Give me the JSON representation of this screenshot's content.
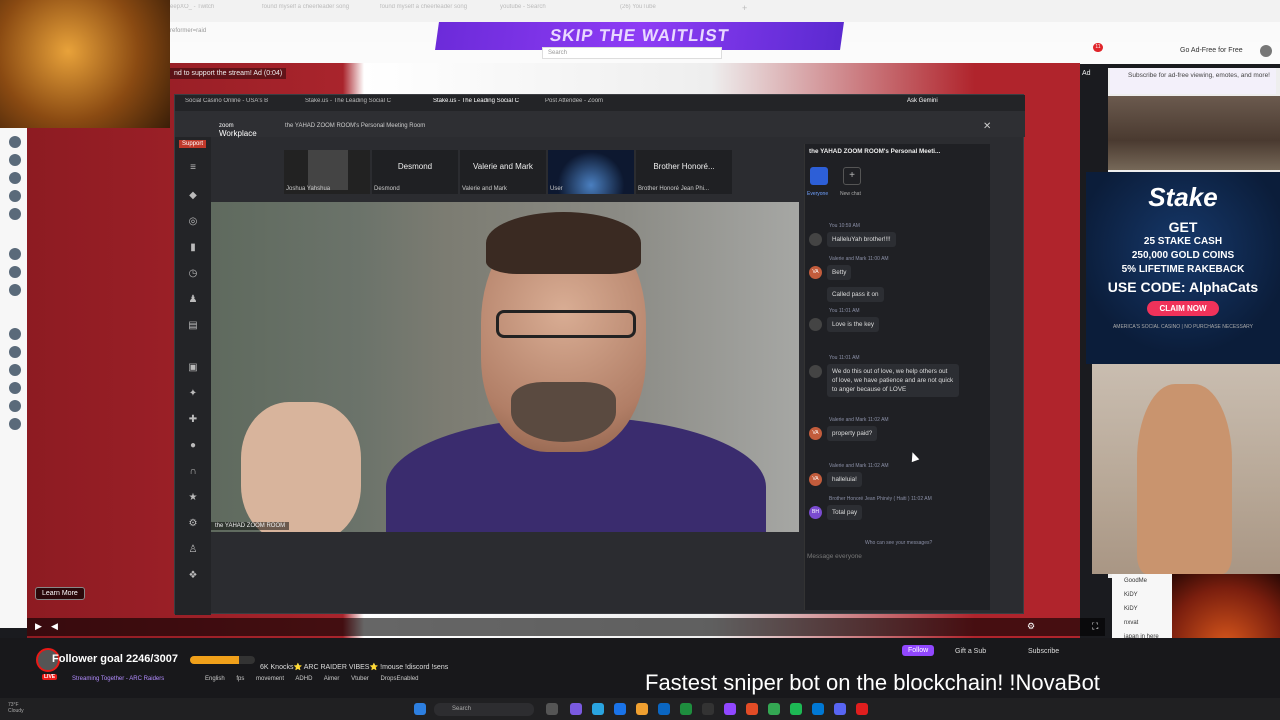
{
  "browser": {
    "tabs": [
      {
        "label": "eepXO_ - Twitch"
      },
      {
        "label": "found myself a cheerleader song"
      },
      {
        "label": "found myself a cheerleader song"
      },
      {
        "label": "youtube - Search"
      },
      {
        "label": "(26) YouTube"
      }
    ],
    "url": "reformer=raid",
    "banner": "SKIP THE WAITLIST",
    "search_placeholder": "Search",
    "ad_free_label": "Go Ad-Free for Free",
    "badge_count": "11"
  },
  "stream": {
    "ad_notice": "nd to support the stream! Ad (0:04)",
    "ad_label": "Ad",
    "learn_more": "Learn More",
    "goal_text": "Follower goal 2246/3007",
    "goal_fraction": 0.75,
    "title": "6K Knocks⭐ ARC RAIDER VIBES⭐ !mouse !discord !sens",
    "live_badge": "LIVE",
    "category": "Streaming Together - ARC Raiders",
    "tags": [
      "English",
      "fps",
      "movement",
      "ADHD",
      "Aimer",
      "Vtuber",
      "DropsEnabled"
    ],
    "follow_label": "Follow",
    "gift_label": "Gift a Sub",
    "subscribe_label": "Subscribe",
    "ticker": "Fastest sniper bot on the blockchain! !NovaBot"
  },
  "inner_browser": {
    "tabs": [
      {
        "label": "Social Casino Online - USA's B"
      },
      {
        "label": "Stake.us - The Leading Social C"
      },
      {
        "label": "Stake.us - The Leading Social C"
      },
      {
        "label": "Post Attendee - Zoom"
      }
    ],
    "ask_gemini": "Ask Gemini"
  },
  "zoom": {
    "logo_top": "zoom",
    "logo_bottom": "Workplace",
    "meeting_title": "the YAHAD ZOOM ROOM's Personal Meeting Room",
    "support_label": "Support",
    "participants": [
      {
        "name": "",
        "label": "Joshua Yahshua"
      },
      {
        "name": "Desmond",
        "label": "Desmond"
      },
      {
        "name": "Valerie and Mark",
        "label": "Valerie and Mark"
      },
      {
        "name": "",
        "label": "User"
      },
      {
        "name": "Brother  Honoré...",
        "label": "Brother Honoré Jean Phi..."
      }
    ],
    "main_video_label": "the YAHAD ZOOM ROOM",
    "chat": {
      "title": "the YAHAD ZOOM ROOM's Personal Meeti...",
      "tab_everyone": "Everyone",
      "tab_new": "New chat",
      "messages": [
        {
          "meta": "You 10:59 AM",
          "text": "HalleluYah brother!!!!",
          "avatar": ""
        },
        {
          "meta": "Valerie and Mark 11:00 AM",
          "text": "Betty",
          "avatar": "VA"
        },
        {
          "meta": "",
          "text": "Called pass it on",
          "avatar": ""
        },
        {
          "meta": "You 11:01 AM",
          "text": "Love is the key",
          "avatar": ""
        },
        {
          "meta": "You 11:01 AM",
          "text": "We do this out of love, we help others out of love, we have patience and are not quick to anger because of LOVE",
          "avatar": ""
        },
        {
          "meta": "Valerie and Mark 11:02 AM",
          "text": "property paid?",
          "avatar": "VA"
        },
        {
          "meta": "Valerie and Mark 11:02 AM",
          "text": "halleluia!",
          "avatar": "VA"
        },
        {
          "meta": "Brother Honoré Jean Phinéy ( Haiti ) 11:02 AM",
          "text": "Total pay",
          "avatar": "BH"
        }
      ],
      "who_can_see": "Who can see your messages?",
      "input_placeholder": "Message everyone"
    }
  },
  "right_ads": {
    "subscribe_ad": "Subscribe for ad-free viewing, emotes, and more!",
    "stake": {
      "logo": "Stake",
      "get": "GET",
      "line1": "25 STAKE CASH",
      "line2": "250,000 GOLD COINS",
      "line3": "5% LIFETIME RAKEBACK",
      "code": "USE CODE: AlphaCats",
      "claim": "CLAIM NOW",
      "fine": "AMERICA'S SOCIAL CASINO | NO PURCHASE NECESSARY"
    },
    "chat_lines": [
      "GoodMe",
      "KiDY",
      "KiDY",
      "nxvat",
      "japan in here"
    ]
  },
  "taskbar": {
    "weather_temp": "73°F",
    "weather_desc": "Cloudy",
    "search": "Search"
  },
  "colors": {
    "twitch_purple": "#9147ff",
    "zoom_bg": "#2b2c30",
    "goal_orange": "#f0a01a"
  }
}
